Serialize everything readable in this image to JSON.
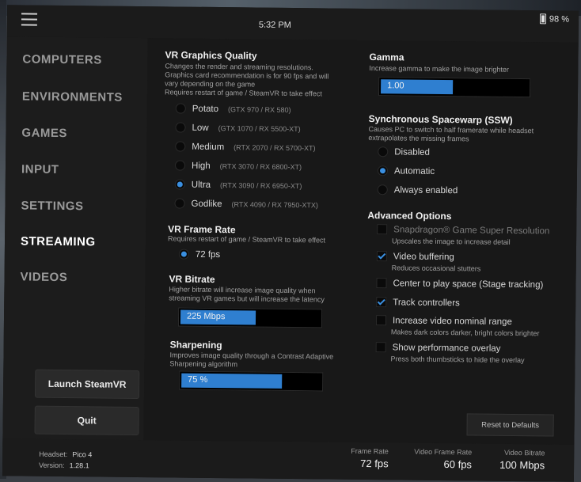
{
  "topbar": {
    "time": "5:32 PM",
    "battery": "98 %"
  },
  "sidebar": {
    "items": [
      {
        "label": "COMPUTERS"
      },
      {
        "label": "ENVIRONMENTS"
      },
      {
        "label": "GAMES"
      },
      {
        "label": "INPUT"
      },
      {
        "label": "SETTINGS"
      },
      {
        "label": "STREAMING",
        "active": true
      },
      {
        "label": "VIDEOS"
      }
    ],
    "launch_label": "Launch SteamVR",
    "quit_label": "Quit"
  },
  "graphics": {
    "title": "VR Graphics Quality",
    "desc1": "Changes the render and streaming resolutions.",
    "desc2": "Graphics card recommendation is for 90 fps and will",
    "desc3": "vary depending on the game",
    "desc4": "Requires restart of game / SteamVR to take effect",
    "options": [
      {
        "label": "Potato",
        "hint": "(GTX 970 / RX 580)",
        "selected": false
      },
      {
        "label": "Low",
        "hint": "(GTX 1070 / RX 5500-XT)",
        "selected": false
      },
      {
        "label": "Medium",
        "hint": "(RTX 2070 / RX 5700-XT)",
        "selected": false
      },
      {
        "label": "High",
        "hint": "(RTX 3070 / RX 6800-XT)",
        "selected": false
      },
      {
        "label": "Ultra",
        "hint": "(RTX 3090 / RX 6950-XT)",
        "selected": true
      },
      {
        "label": "Godlike",
        "hint": "(RTX 4090 / RX 7950-XTX)",
        "selected": false
      }
    ]
  },
  "framerate": {
    "title": "VR Frame Rate",
    "desc": "Requires restart of game / SteamVR to take effect",
    "option": "72 fps"
  },
  "bitrate": {
    "title": "VR Bitrate",
    "desc1": "Higher bitrate will increase image quality when",
    "desc2": "streaming VR games but will increase the latency",
    "value": "225 Mbps",
    "fill_fraction": 0.55
  },
  "sharpening": {
    "title": "Sharpening",
    "desc1": "Improves image quality through a Contrast Adaptive",
    "desc2": "Sharpening algorithm",
    "value": "75 %",
    "fill_fraction": 0.73
  },
  "gamma": {
    "title": "Gamma",
    "desc": "Increase gamma to make the image brighter",
    "value": "1.00",
    "fill_fraction": 0.5
  },
  "ssw": {
    "title": "Synchronous Spacewarp (SSW)",
    "desc1": "Causes PC to switch to half framerate while headset",
    "desc2": "extrapolates the missing frames",
    "options": [
      {
        "label": "Disabled",
        "selected": false
      },
      {
        "label": "Automatic",
        "selected": true
      },
      {
        "label": "Always enabled",
        "selected": false
      }
    ]
  },
  "advanced": {
    "title": "Advanced Options",
    "options": [
      {
        "label": "Snapdragon® Game Super Resolution",
        "desc": "Upscales the image to increase detail",
        "checked": false,
        "disabled": true
      },
      {
        "label": "Video buffering",
        "desc": "Reduces occasional stutters",
        "checked": true,
        "disabled": false
      },
      {
        "label": "Center to play space (Stage tracking)",
        "desc": "",
        "checked": false,
        "disabled": false
      },
      {
        "label": "Track controllers",
        "desc": "",
        "checked": true,
        "disabled": false
      },
      {
        "label": "Increase video nominal range",
        "desc": "Makes dark colors darker, bright colors brighter",
        "checked": false,
        "disabled": false
      },
      {
        "label": "Show performance overlay",
        "desc": "Press both thumbsticks to hide the overlay",
        "checked": false,
        "disabled": false
      }
    ],
    "reset_label": "Reset to Defaults"
  },
  "footer": {
    "headset_label": "Headset:",
    "headset_value": "Pico 4",
    "version_label": "Version:",
    "version_value": "1.28.1",
    "stats": [
      {
        "label": "Frame Rate",
        "value": "72 fps"
      },
      {
        "label": "Video Frame Rate",
        "value": "60 fps"
      },
      {
        "label": "Video Bitrate",
        "value": "100 Mbps"
      }
    ]
  },
  "colors": {
    "accent": "#3a8fe0",
    "panel": "#161616"
  }
}
